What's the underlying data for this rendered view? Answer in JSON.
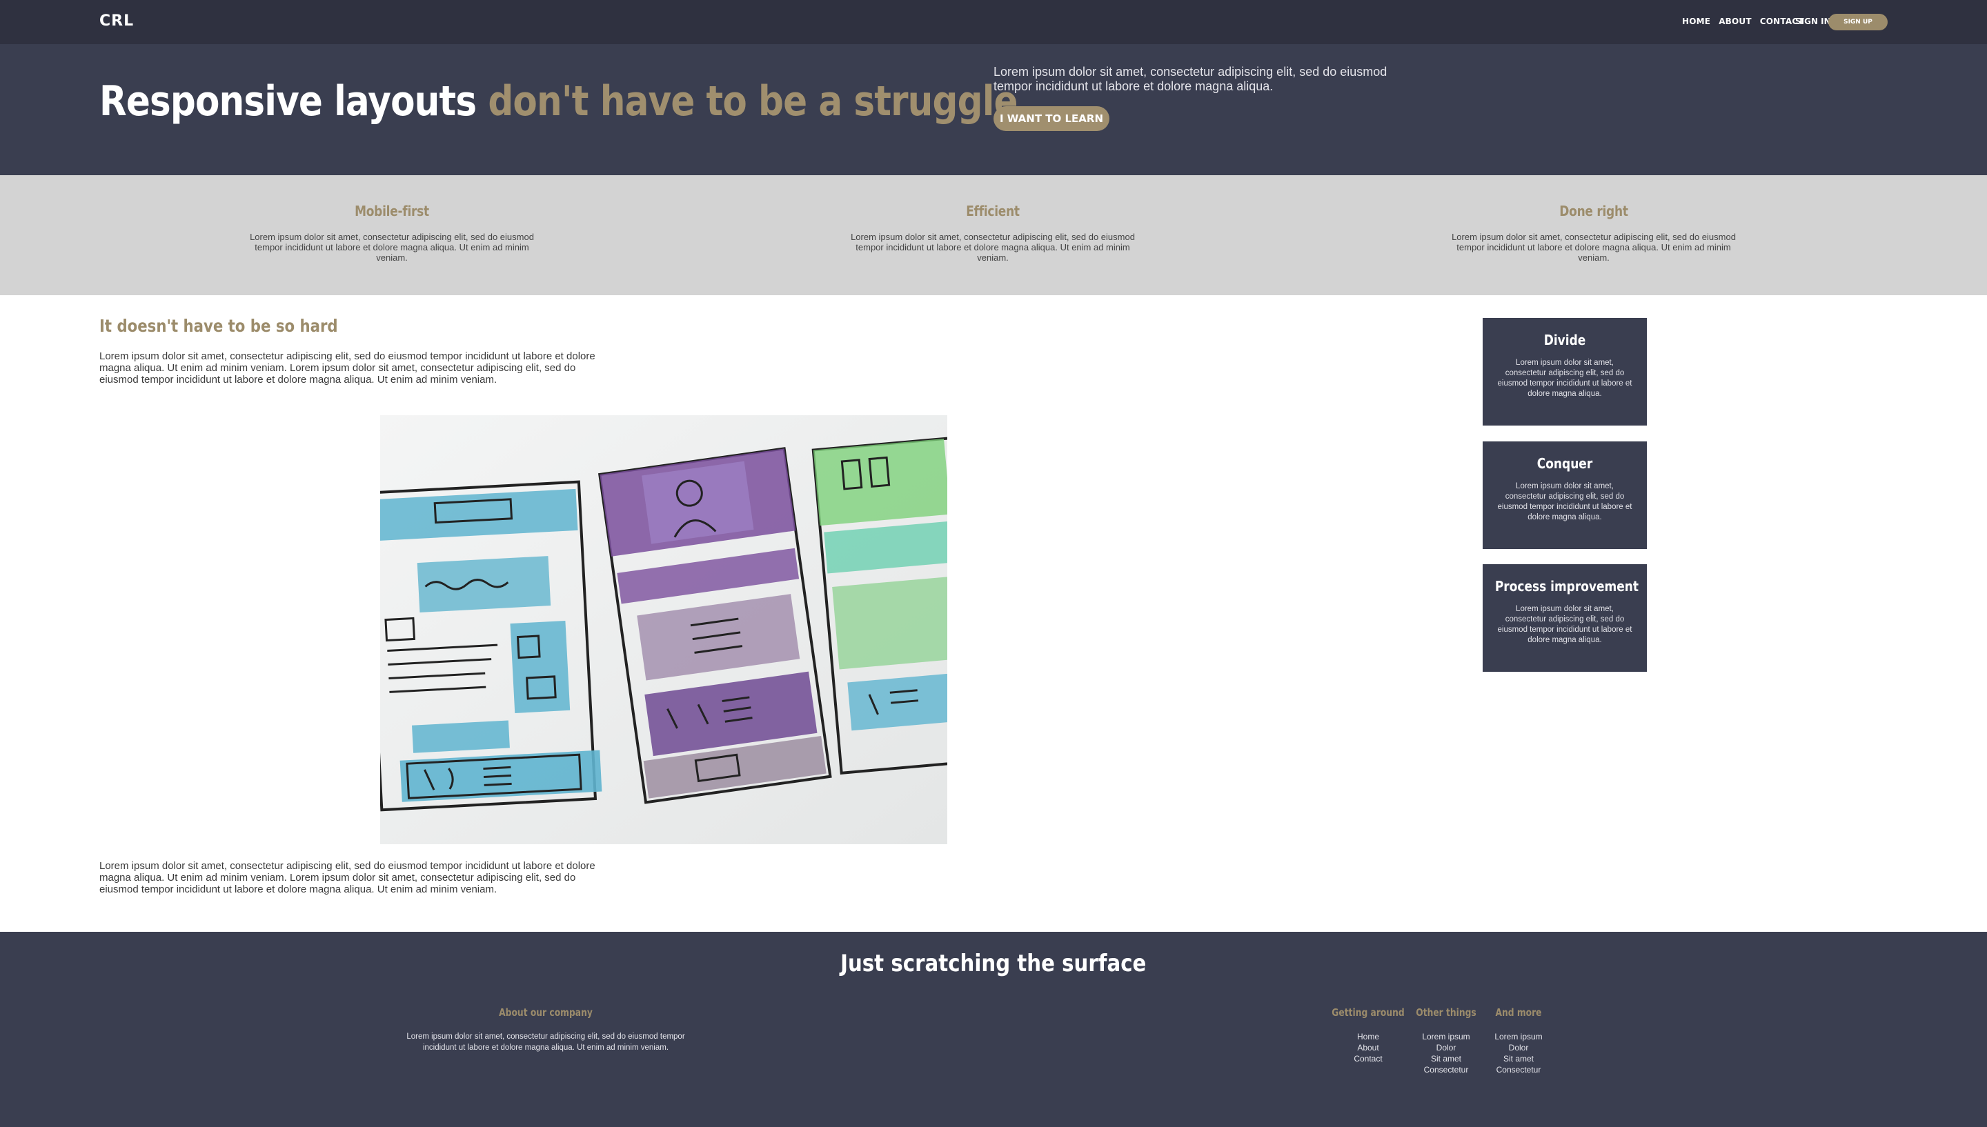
{
  "brand": {
    "logo": "CRL",
    "accent_color": "#a08f6e",
    "dark_color": "#3a3e50"
  },
  "nav": {
    "links": [
      "HOME",
      "ABOUT",
      "CONTACT"
    ],
    "signin": "SIGN IN",
    "signup": "SIGN UP"
  },
  "hero": {
    "title_main": "Responsive layouts",
    "title_accent": "don't have to be a struggle",
    "text": "Lorem ipsum dolor sit amet, consectetur adipiscing elit, sed do eiusmod tempor incididunt ut labore et dolore magna aliqua.",
    "button": "I WANT TO LEARN"
  },
  "features": [
    {
      "title": "Mobile-first",
      "text": "Lorem ipsum dolor sit amet, consectetur adipiscing elit, sed do eiusmod tempor incididunt ut labore et dolore magna aliqua. Ut enim ad minim veniam."
    },
    {
      "title": "Efficient",
      "text": "Lorem ipsum dolor sit amet, consectetur adipiscing elit, sed do eiusmod tempor incididunt ut labore et dolore magna aliqua. Ut enim ad minim veniam."
    },
    {
      "title": "Done right",
      "text": "Lorem ipsum dolor sit amet, consectetur adipiscing elit, sed do eiusmod tempor incididunt ut labore et dolore magna aliqua. Ut enim ad minim veniam."
    }
  ],
  "main": {
    "title": "It doesn't have to be so hard",
    "para1": "Lorem ipsum dolor sit amet, consectetur adipiscing elit, sed do eiusmod tempor incididunt ut labore et dolore magna aliqua. Ut enim ad minim veniam. Lorem ipsum dolor sit amet, consectetur adipiscing elit, sed do eiusmod tempor incididunt ut labore et dolore magna aliqua. Ut enim ad minim veniam.",
    "para2": "Lorem ipsum dolor sit amet, consectetur adipiscing elit, sed do eiusmod tempor incididunt ut labore et dolore magna aliqua. Ut enim ad minim veniam. Lorem ipsum dolor sit amet, consectetur adipiscing elit, sed do eiusmod tempor incididunt ut labore et dolore magna aliqua. Ut enim ad minim veniam."
  },
  "sidebar": [
    {
      "title": "Divide",
      "text": "Lorem ipsum dolor sit amet, consectetur adipiscing elit, sed do eiusmod tempor incididunt ut labore et dolore magna aliqua."
    },
    {
      "title": "Conquer",
      "text": "Lorem ipsum dolor sit amet, consectetur adipiscing elit, sed do eiusmod tempor incididunt ut labore et dolore magna aliqua."
    },
    {
      "title": "Process improvement",
      "text": "Lorem ipsum dolor sit amet, consectetur adipiscing elit, sed do eiusmod tempor incididunt ut labore et dolore magna aliqua."
    }
  ],
  "footer": {
    "title": "Just scratching the surface",
    "about_title": "About our company",
    "about_text": "Lorem ipsum dolor sit amet, consectetur adipiscing elit, sed do eiusmod tempor incididunt ut labore et dolore magna aliqua. Ut enim ad minim veniam.",
    "columns": [
      {
        "title": "Getting around",
        "items": [
          "Home",
          "About",
          "Contact"
        ]
      },
      {
        "title": "Other things",
        "items": [
          "Lorem ipsum",
          "Dolor",
          "Sit amet",
          "Consectetur"
        ]
      },
      {
        "title": "And more",
        "items": [
          "Lorem ipsum",
          "Dolor",
          "Sit amet",
          "Consectetur"
        ]
      }
    ]
  }
}
